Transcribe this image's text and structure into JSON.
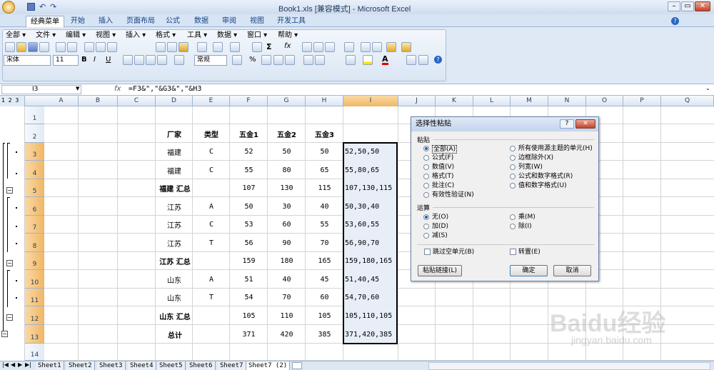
{
  "title": {
    "text": "Book1.xls  [兼容模式] - Microsoft Excel"
  },
  "tabs": [
    "经典菜单",
    "开始",
    "插入",
    "页面布局",
    "公式",
    "数据",
    "审阅",
    "视图",
    "开发工具"
  ],
  "menus": [
    "全部 ▾",
    "文件 ▾",
    "编辑 ▾",
    "视图 ▾",
    "插入 ▾",
    "格式 ▾",
    "工具 ▾",
    "数据 ▾",
    "窗口 ▾",
    "帮助 ▾"
  ],
  "font": {
    "name": "宋体",
    "size": "11",
    "style": "常规"
  },
  "namebox": "I3",
  "fx": "fx",
  "formula": "=F3&\",\"&G3&\",\"&H3",
  "outline_levels": "1 2 3",
  "columns": [
    "A",
    "B",
    "C",
    "D",
    "E",
    "F",
    "G",
    "H",
    "I",
    "J",
    "K",
    "L",
    "M",
    "N",
    "O",
    "P",
    "Q"
  ],
  "rows": [
    {
      "n": "1",
      "d": "",
      "e": "",
      "f": "",
      "g": "",
      "h": "",
      "i": ""
    },
    {
      "n": "2",
      "d": "厂家",
      "e": "类型",
      "f": "五金1",
      "g": "五金2",
      "h": "五金3",
      "i": "",
      "bold": true
    },
    {
      "n": "3",
      "d": "福建",
      "e": "C",
      "f": "52",
      "g": "50",
      "h": "50",
      "i": "52,50,50"
    },
    {
      "n": "4",
      "d": "福建",
      "e": "C",
      "f": "55",
      "g": "80",
      "h": "65",
      "i": "55,80,65"
    },
    {
      "n": "5",
      "d": "福建 汇总",
      "e": "",
      "f": "107",
      "g": "130",
      "h": "115",
      "i": "107,130,115",
      "sum": true
    },
    {
      "n": "6",
      "d": "江苏",
      "e": "A",
      "f": "50",
      "g": "30",
      "h": "40",
      "i": "50,30,40"
    },
    {
      "n": "7",
      "d": "江苏",
      "e": "C",
      "f": "53",
      "g": "60",
      "h": "55",
      "i": "53,60,55"
    },
    {
      "n": "8",
      "d": "江苏",
      "e": "T",
      "f": "56",
      "g": "90",
      "h": "70",
      "i": "56,90,70"
    },
    {
      "n": "9",
      "d": "江苏 汇总",
      "e": "",
      "f": "159",
      "g": "180",
      "h": "165",
      "i": "159,180,165",
      "sum": true
    },
    {
      "n": "10",
      "d": "山东",
      "e": "A",
      "f": "51",
      "g": "40",
      "h": "45",
      "i": "51,40,45"
    },
    {
      "n": "11",
      "d": "山东",
      "e": "T",
      "f": "54",
      "g": "70",
      "h": "60",
      "i": "54,70,60"
    },
    {
      "n": "12",
      "d": "山东 汇总",
      "e": "",
      "f": "105",
      "g": "110",
      "h": "105",
      "i": "105,110,105",
      "sum": true
    },
    {
      "n": "13",
      "d": "总计",
      "e": "",
      "f": "371",
      "g": "420",
      "h": "385",
      "i": "371,420,385",
      "sum": true
    },
    {
      "n": "14",
      "d": "",
      "e": "",
      "f": "",
      "g": "",
      "h": "",
      "i": ""
    }
  ],
  "sheets": [
    "Sheet1",
    "Sheet2",
    "Sheet3",
    "Sheet4",
    "Sheet5",
    "Sheet6",
    "Sheet7",
    "Sheet7 (2)"
  ],
  "dialog": {
    "title": "选择性粘贴",
    "help": "?",
    "close": "✕",
    "paste_group": "粘贴",
    "paste_left": [
      "全部(A)",
      "公式(F)",
      "数值(V)",
      "格式(T)",
      "批注(C)",
      "有效性验证(N)"
    ],
    "paste_right": [
      "所有使用源主题的单元(H)",
      "边框除外(X)",
      "列宽(W)",
      "公式和数字格式(R)",
      "值和数字格式(U)"
    ],
    "op_group": "运算",
    "op_left": [
      "无(O)",
      "加(D)",
      "减(S)"
    ],
    "op_right": [
      "乘(M)",
      "除(I)"
    ],
    "skip_blanks": "跳过空单元(B)",
    "transpose": "转置(E)",
    "paste_link": "粘贴链接(L)",
    "ok": "确定",
    "cancel": "取消"
  },
  "watermark": {
    "brand": "Baidu经验",
    "url": "jingyan.baidu.com"
  }
}
